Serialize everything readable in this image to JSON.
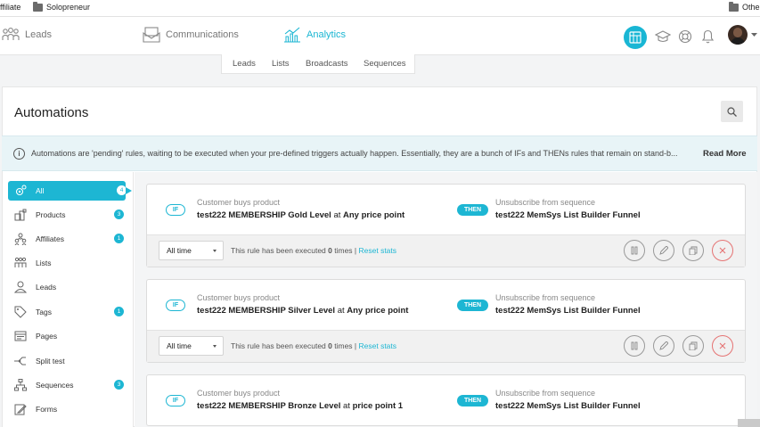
{
  "bookmarks": {
    "left": "ffiliate",
    "solo": "Solopreneur",
    "right": "Othe"
  },
  "nav": {
    "leads": "Leads",
    "communications": "Communications",
    "analytics": "Analytics"
  },
  "subtabs": [
    "Leads",
    "Lists",
    "Broadcasts",
    "Sequences"
  ],
  "page": {
    "title": "Automations",
    "info": "Automations are 'pending' rules, waiting to be executed when your pre-defined triggers actually happen. Essentially, they are a bunch of IFs and THENs rules that remain on stand-b...",
    "read_more": "Read More"
  },
  "sidebar": [
    {
      "label": "All",
      "badge": "4",
      "icon": "gear-icon"
    },
    {
      "label": "Products",
      "badge": "3",
      "icon": "products-icon"
    },
    {
      "label": "Affiliates",
      "badge": "1",
      "icon": "affiliates-icon"
    },
    {
      "label": "Lists",
      "badge": "",
      "icon": "lists-icon"
    },
    {
      "label": "Leads",
      "badge": "",
      "icon": "leads-icon"
    },
    {
      "label": "Tags",
      "badge": "1",
      "icon": "tag-icon"
    },
    {
      "label": "Pages",
      "badge": "",
      "icon": "pages-icon"
    },
    {
      "label": "Split test",
      "badge": "",
      "icon": "split-test-icon"
    },
    {
      "label": "Sequences",
      "badge": "3",
      "icon": "sequences-icon"
    },
    {
      "label": "Forms",
      "badge": "",
      "icon": "forms-icon"
    }
  ],
  "rules": [
    {
      "if": "IF",
      "then": "THEN",
      "cond_label": "Customer buys product",
      "cond_product": "test222 MEMBERSHIP Gold Level",
      "cond_at": " at ",
      "cond_price": "Any price point",
      "act_label": "Unsubscribe from sequence",
      "act_value": "test222 MemSys List Builder Funnel",
      "period": "All time",
      "exec_pre": "This rule has been executed ",
      "exec_count": "0",
      "exec_post": " times | ",
      "reset": "Reset stats"
    },
    {
      "if": "IF",
      "then": "THEN",
      "cond_label": "Customer buys product",
      "cond_product": "test222 MEMBERSHIP Silver Level",
      "cond_at": " at ",
      "cond_price": "Any price point",
      "act_label": "Unsubscribe from sequence",
      "act_value": "test222 MemSys List Builder Funnel",
      "period": "All time",
      "exec_pre": "This rule has been executed ",
      "exec_count": "0",
      "exec_post": " times | ",
      "reset": "Reset stats"
    },
    {
      "if": "IF",
      "then": "THEN",
      "cond_label": "Customer buys product",
      "cond_product": "test222 MEMBERSHIP Bronze Level",
      "cond_at": " at ",
      "cond_price": "price point 1",
      "act_label": "Unsubscribe from sequence",
      "act_value": "test222 MemSys List Builder Funnel",
      "period": "All time",
      "exec_pre": "This rule has been executed ",
      "exec_count": "0",
      "exec_post": " times | ",
      "reset": "Reset stats"
    }
  ],
  "colors": {
    "accent": "#1db6d3",
    "delete": "#e57373"
  }
}
